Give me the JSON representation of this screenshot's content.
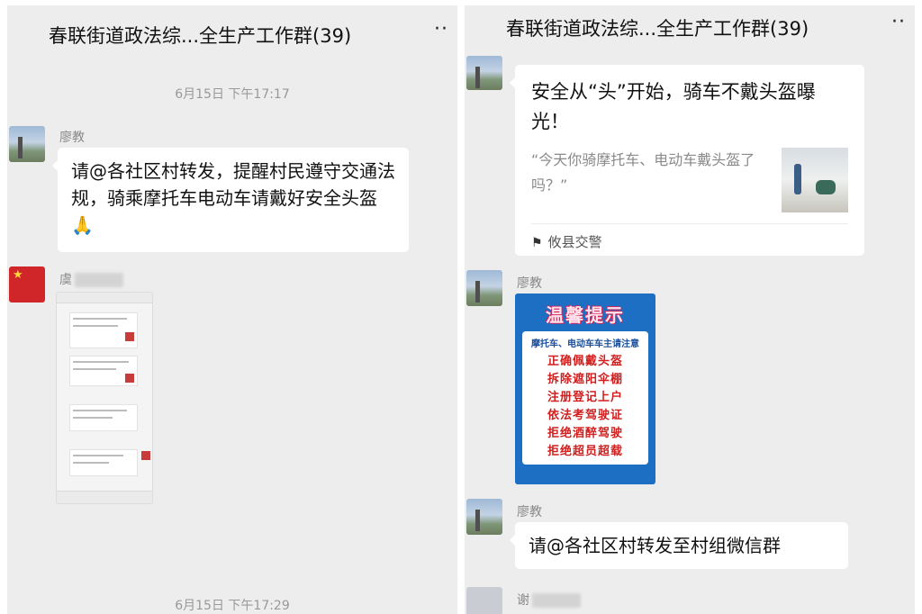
{
  "left": {
    "title": "春联街道政法综...全生产工作群(39)",
    "more": "··",
    "timestamp_top": "6月15日 下午17:17",
    "msg1": {
      "sender": "廖教",
      "text": "请@各社区村转发，提醒村民遵守交通法规，骑乘摩托车电动车请戴好安全头盔🙏"
    },
    "msg2": {
      "sender": "虞"
    },
    "timestamp_bottom": "6月15日 下午17:29"
  },
  "right": {
    "title": "春联街道政法综...全生产工作群(39)",
    "more": "··",
    "link_card": {
      "title": "安全从“头”开始，骑车不戴头盔曝光！",
      "description": "“今天你骑摩托车、电动车戴头盔了吗？”",
      "source": "攸县交警"
    },
    "msg_poster": {
      "sender": "廖教",
      "poster_heading": "温馨提示",
      "poster_subtitle": "摩托车、电动车车主请注意",
      "poster_lines": [
        "正确佩戴头盔",
        "拆除遮阳伞棚",
        "注册登记上户",
        "依法考驾驶证",
        "拒绝酒醉驾驶",
        "拒绝超员超载"
      ]
    },
    "msg3": {
      "sender": "廖教",
      "text": "请@各社区村转发至村组微信群"
    },
    "msg4": {
      "sender": "谢"
    }
  }
}
